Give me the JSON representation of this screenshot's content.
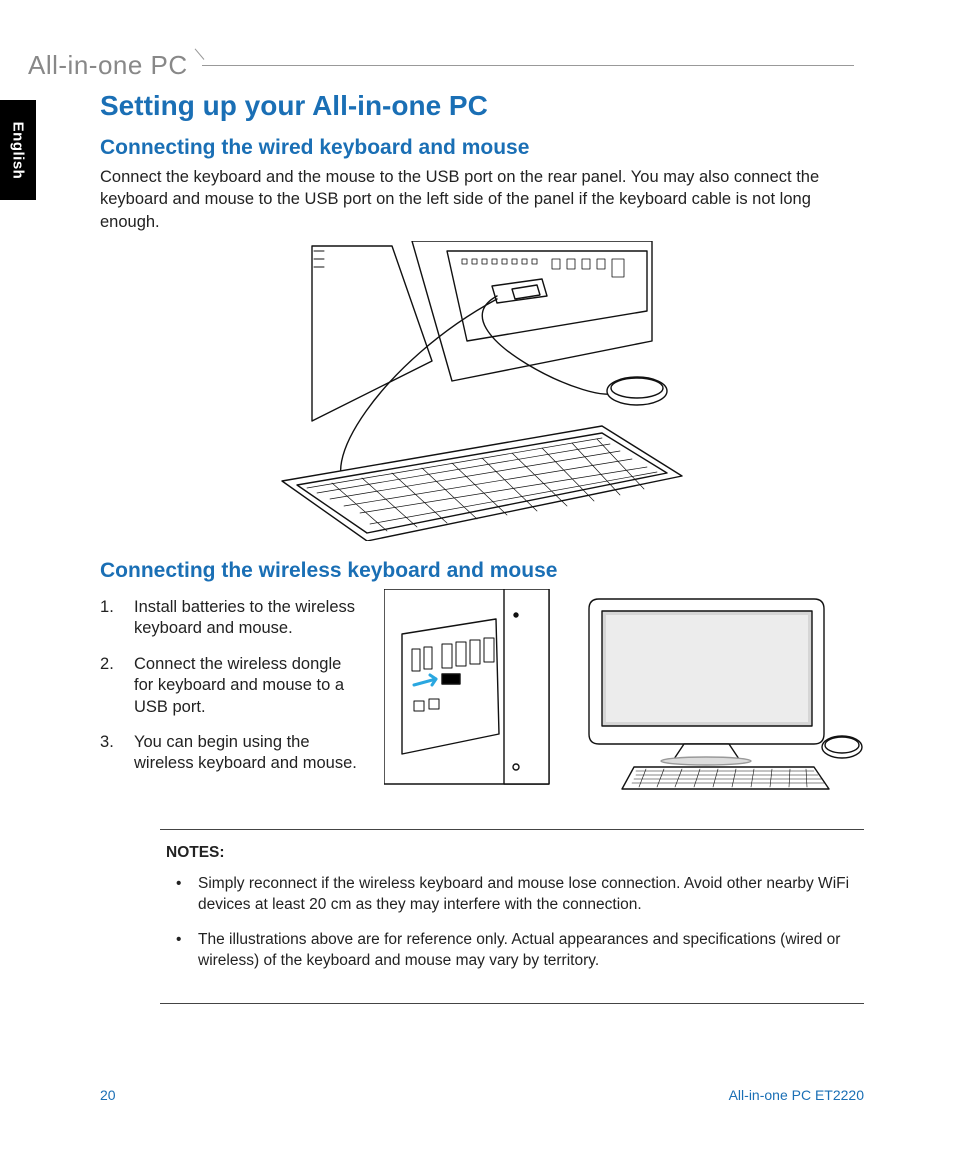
{
  "header": {
    "product_line": "All-in-one PC"
  },
  "lang_tab": "English",
  "main": {
    "title": "Setting up your All-in-one PC",
    "section1": {
      "heading": "Connecting the wired keyboard and mouse",
      "paragraph": "Connect the keyboard and the mouse to the USB port on the rear panel. You may also connect the keyboard and mouse to the USB port on the left side of the panel if the keyboard cable is not long enough."
    },
    "section2": {
      "heading": "Connecting the wireless keyboard and mouse",
      "steps": [
        "Install batteries to the wireless keyboard and mouse.",
        "Connect the wireless dongle for keyboard and mouse to a USB port.",
        "You can begin using the wireless keyboard and mouse."
      ]
    },
    "notes": {
      "label": "NOTES:",
      "items": [
        "Simply reconnect if the wireless keyboard and mouse lose connection.  Avoid other nearby WiFi devices at least 20 cm as they may interfere with the connection.",
        "The illustrations above are for reference only. Actual appearances and specifications (wired or wireless) of the keyboard and mouse may vary by territory."
      ]
    }
  },
  "footer": {
    "page": "20",
    "model": "All-in-one PC ET2220"
  }
}
